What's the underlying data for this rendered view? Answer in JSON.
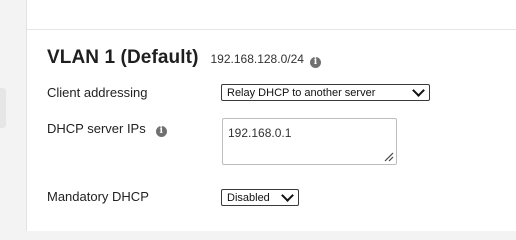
{
  "vlan": {
    "title": "VLAN 1 (Default)",
    "subnet": "192.168.128.0/24"
  },
  "client_addressing": {
    "label": "Client addressing",
    "value": "Relay DHCP to another server"
  },
  "dhcp_server_ips": {
    "label": "DHCP server IPs",
    "value": "192.168.0.1"
  },
  "mandatory_dhcp": {
    "label": "Mandatory DHCP",
    "value": "Disabled"
  },
  "icons": {
    "info": "info-icon",
    "dropdown": "chevron-down-icon",
    "resize": "resize-handle-icon"
  }
}
